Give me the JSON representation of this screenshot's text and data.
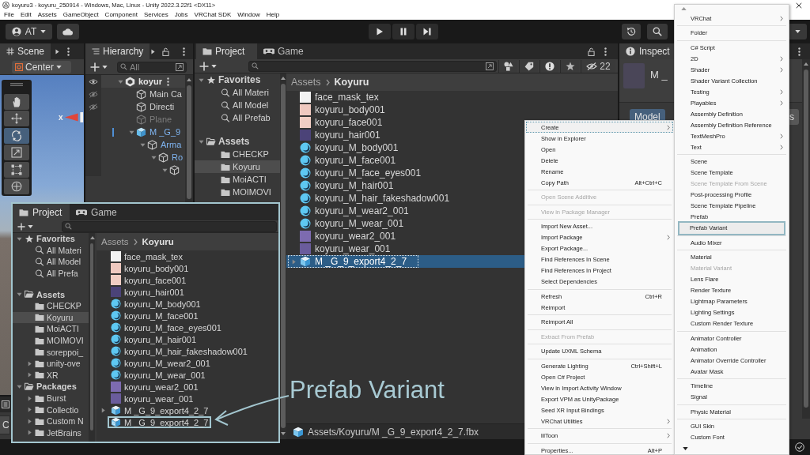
{
  "window": {
    "title": "koyuru3 - koyuru_250914 - Windows, Mac, Linux - Unity 2022.3.22f1 <DX11>"
  },
  "menu_bar": [
    "File",
    "Edit",
    "Assets",
    "GameObject",
    "Component",
    "Services",
    "Jobs",
    "VRChat SDK",
    "Window",
    "Help"
  ],
  "toolbar": {
    "account": "AT"
  },
  "scene": {
    "tab": "Scene",
    "pivot": "Center",
    "axis_label": "x",
    "tools": [
      {
        "kind": "hand",
        "selected": false
      },
      {
        "kind": "move",
        "selected": false
      },
      {
        "kind": "rotate",
        "selected": true
      },
      {
        "kind": "scale",
        "selected": false
      },
      {
        "kind": "rect",
        "selected": false
      },
      {
        "kind": "transform",
        "selected": false
      }
    ]
  },
  "hierarchy": {
    "tab": "Hierarchy",
    "placeholder": "All",
    "items": [
      {
        "label": "koyur",
        "kind": "scene",
        "scene_visible": true,
        "active": true,
        "expanded": true,
        "children": [
          {
            "label": "Main Ca",
            "kind": "object",
            "scene_visible": false,
            "active": true
          },
          {
            "label": "Directi",
            "kind": "object",
            "scene_visible": false,
            "active": true
          },
          {
            "label": "Plane",
            "kind": "object",
            "active": false
          },
          {
            "label": "M _G_9",
            "kind": "prefab",
            "active": true,
            "expanded": true,
            "children": [
              {
                "label": "Arma",
                "kind": "prefab_child",
                "active": true,
                "expanded": true,
                "children": [
                  {
                    "label": "Ro",
                    "kind": "prefab_child",
                    "active": true,
                    "expanded": true,
                    "children": [
                      {
                        "kind": "object",
                        "active": true,
                        "expanded": true
                      }
                    ]
                  }
                ]
              }
            ]
          }
        ]
      }
    ]
  },
  "console": {
    "button": "C"
  },
  "project": {
    "tabs": [
      {
        "kind": "project",
        "label": "Project",
        "selected": true
      },
      {
        "kind": "game",
        "label": "Game",
        "selected": false
      }
    ],
    "hidden_count": "22",
    "sidebar": [
      {
        "label": "Favorites",
        "kind": "favorites",
        "expanded": true,
        "selected": false,
        "children": [
          {
            "label": "All Materi",
            "kind": "search",
            "selected": false
          },
          {
            "label": "All Model",
            "kind": "search",
            "selected": false
          },
          {
            "label": "All Prefab",
            "kind": "search",
            "selected": false
          }
        ]
      },
      {
        "label": "Assets",
        "kind": "assets",
        "expanded": true,
        "selected": false,
        "children": [
          {
            "label": "CHECKP",
            "kind": "folder",
            "selected": false
          },
          {
            "label": "Koyuru",
            "kind": "folder",
            "selected": true
          },
          {
            "label": "MoiACTI",
            "kind": "folder",
            "selected": false
          },
          {
            "label": "MOIMOVI",
            "kind": "folder",
            "selected": false
          }
        ]
      }
    ],
    "breadcrumb": [
      "Assets",
      "Koyuru"
    ],
    "assets": [
      {
        "name": "face_mask_tex",
        "kind": "texture",
        "color": "#f2f2f2",
        "selected": false
      },
      {
        "name": "koyuru_body001",
        "kind": "texture",
        "color": "#efc9c0",
        "selected": false
      },
      {
        "name": "koyuru_face001",
        "kind": "texture",
        "color": "#f1cec4",
        "selected": false
      },
      {
        "name": "koyuru_hair001",
        "kind": "texture",
        "color": "#4b4378",
        "selected": false
      },
      {
        "name": "koyuru_M_body001",
        "kind": "material",
        "selected": false
      },
      {
        "name": "koyuru_M_face001",
        "kind": "material",
        "selected": false
      },
      {
        "name": "koyuru_M_face_eyes001",
        "kind": "material",
        "selected": false
      },
      {
        "name": "koyuru_M_hair001",
        "kind": "material",
        "selected": false
      },
      {
        "name": "koyuru_M_hair_fakeshadow001",
        "kind": "material",
        "selected": false
      },
      {
        "name": "koyuru_M_wear2_001",
        "kind": "material",
        "selected": false
      },
      {
        "name": "koyuru_M_wear_001",
        "kind": "material",
        "selected": false
      },
      {
        "name": "koyuru_wear2_001",
        "kind": "texture",
        "color": "#7d6bb0",
        "selected": false
      },
      {
        "name": "koyuru_wear_001",
        "kind": "texture",
        "color": "#6a5c9c",
        "selected": false
      },
      {
        "name": "M _G_9_export4_2_7",
        "kind": "model",
        "expanded": false,
        "selected": true
      }
    ],
    "path": "Assets/Koyuru/M _G_9_export4_2_7.fbx"
  },
  "inspector": {
    "tab": "Inspect",
    "title": "M _",
    "tabs": [
      {
        "label": "Model",
        "selected": true
      },
      {
        "label": "s",
        "selected": false
      }
    ]
  },
  "callout": {
    "tabs": [
      {
        "kind": "project",
        "label": "Project",
        "selected": true
      },
      {
        "kind": "game",
        "label": "Game",
        "selected": false
      }
    ],
    "sidebar": [
      {
        "label": "Favorites",
        "kind": "favorites",
        "expanded": true,
        "selected": false,
        "children": [
          {
            "label": "All Materi",
            "kind": "search",
            "selected": false
          },
          {
            "label": "All Model",
            "kind": "search",
            "selected": false
          },
          {
            "label": "All Prefa",
            "kind": "search",
            "selected": false
          }
        ]
      },
      {
        "label": "Assets",
        "kind": "assets",
        "expanded": true,
        "selected": false,
        "children": [
          {
            "label": "CHECKP",
            "kind": "folder",
            "selected": false
          },
          {
            "label": "Koyuru",
            "kind": "folder",
            "selected": true
          },
          {
            "label": "MoiACTI",
            "kind": "folder",
            "selected": false
          },
          {
            "label": "MOIMOVI",
            "kind": "folder",
            "selected": false
          },
          {
            "label": "soreppoi_",
            "kind": "folder",
            "selected": false
          },
          {
            "label": "unity-ove",
            "kind": "folder",
            "expanded": false,
            "selected": false
          },
          {
            "label": "XR",
            "kind": "folder",
            "expanded": false,
            "selected": false
          }
        ]
      },
      {
        "label": "Packages",
        "kind": "packages",
        "expanded": true,
        "selected": false,
        "children": [
          {
            "label": "Burst",
            "kind": "folder",
            "expanded": false,
            "selected": false
          },
          {
            "label": "Collectio",
            "kind": "folder",
            "expanded": false,
            "selected": false
          },
          {
            "label": "Custom N",
            "kind": "folder",
            "expanded": false,
            "selected": false
          },
          {
            "label": "JetBrains",
            "kind": "folder",
            "expanded": false,
            "selected": false
          }
        ]
      }
    ],
    "breadcrumb": [
      "Assets",
      "Koyuru"
    ],
    "assets": [
      {
        "name": "face_mask_tex",
        "kind": "texture",
        "color": "#f2f2f2",
        "outlined": false
      },
      {
        "name": "koyuru_body001",
        "kind": "texture",
        "color": "#efc9c0",
        "outlined": false
      },
      {
        "name": "koyuru_face001",
        "kind": "texture",
        "color": "#f1cec4",
        "outlined": false
      },
      {
        "name": "koyuru_hair001",
        "kind": "texture",
        "color": "#4b4378",
        "outlined": false
      },
      {
        "name": "koyuru_M_body001",
        "kind": "material",
        "outlined": false
      },
      {
        "name": "koyuru_M_face001",
        "kind": "material",
        "outlined": false
      },
      {
        "name": "koyuru_M_face_eyes001",
        "kind": "material",
        "outlined": false
      },
      {
        "name": "koyuru_M_hair001",
        "kind": "material",
        "outlined": false
      },
      {
        "name": "koyuru_M_hair_fakeshadow001",
        "kind": "material",
        "outlined": false
      },
      {
        "name": "koyuru_M_wear2_001",
        "kind": "material",
        "outlined": false
      },
      {
        "name": "koyuru_M_wear_001",
        "kind": "material",
        "outlined": false
      },
      {
        "name": "koyuru_wear2_001",
        "kind": "texture",
        "color": "#7d6bb0",
        "outlined": false
      },
      {
        "name": "koyuru_wear_001",
        "kind": "texture",
        "color": "#6a5c9c",
        "outlined": false
      },
      {
        "name": "M _G_9_export4_2_7",
        "kind": "model",
        "expanded": false,
        "outlined": false
      },
      {
        "name": "M _G_9_export4_2_7",
        "kind": "variant",
        "outlined": true
      }
    ]
  },
  "annotation": {
    "label": "Prefab Variant"
  },
  "context_menu": {
    "items": [
      {
        "kind": "item",
        "label": "Create",
        "selected": true,
        "disabled": false,
        "submenu": true
      },
      {
        "kind": "item",
        "label": "Show in Explorer",
        "selected": false,
        "disabled": false,
        "submenu": false
      },
      {
        "kind": "item",
        "label": "Open",
        "selected": false,
        "disabled": false,
        "submenu": false
      },
      {
        "kind": "item",
        "label": "Delete",
        "selected": false,
        "disabled": false,
        "submenu": false
      },
      {
        "kind": "item",
        "label": "Rename",
        "selected": false,
        "disabled": false,
        "submenu": false
      },
      {
        "kind": "item",
        "label": "Copy Path",
        "shortcut": "Alt+Ctrl+C",
        "selected": false,
        "disabled": false,
        "submenu": false
      },
      {
        "kind": "separator"
      },
      {
        "kind": "item",
        "label": "Open Scene Additive",
        "selected": false,
        "disabled": true,
        "submenu": false
      },
      {
        "kind": "separator"
      },
      {
        "kind": "item",
        "label": "View in Package Manager",
        "selected": false,
        "disabled": true,
        "submenu": false
      },
      {
        "kind": "separator"
      },
      {
        "kind": "item",
        "label": "Import New Asset...",
        "selected": false,
        "disabled": false,
        "submenu": false
      },
      {
        "kind": "item",
        "label": "Import Package",
        "selected": false,
        "disabled": false,
        "submenu": true
      },
      {
        "kind": "item",
        "label": "Export Package...",
        "selected": false,
        "disabled": false,
        "submenu": false
      },
      {
        "kind": "item",
        "label": "Find References In Scene",
        "selected": false,
        "disabled": false,
        "submenu": false
      },
      {
        "kind": "item",
        "label": "Find References In Project",
        "selected": false,
        "disabled": false,
        "submenu": false
      },
      {
        "kind": "item",
        "label": "Select Dependencies",
        "selected": false,
        "disabled": false,
        "submenu": false
      },
      {
        "kind": "separator"
      },
      {
        "kind": "item",
        "label": "Refresh",
        "shortcut": "Ctrl+R",
        "selected": false,
        "disabled": false,
        "submenu": false
      },
      {
        "kind": "item",
        "label": "Reimport",
        "selected": false,
        "disabled": false,
        "submenu": false
      },
      {
        "kind": "separator"
      },
      {
        "kind": "item",
        "label": "Reimport All",
        "selected": false,
        "disabled": false,
        "submenu": false
      },
      {
        "kind": "separator"
      },
      {
        "kind": "item",
        "label": "Extract From Prefab",
        "selected": false,
        "disabled": true,
        "submenu": false
      },
      {
        "kind": "separator"
      },
      {
        "kind": "item",
        "label": "Update UXML Schema",
        "selected": false,
        "disabled": false,
        "submenu": false
      },
      {
        "kind": "separator"
      },
      {
        "kind": "item",
        "label": "Generate Lighting",
        "shortcut": "Ctrl+Shift+L",
        "selected": false,
        "disabled": false,
        "submenu": false
      },
      {
        "kind": "item",
        "label": "Open C# Project",
        "selected": false,
        "disabled": false,
        "submenu": false
      },
      {
        "kind": "item",
        "label": "View in Import Activity Window",
        "selected": false,
        "disabled": false,
        "submenu": false
      },
      {
        "kind": "item",
        "label": "Export VPM as UnityPackage",
        "selected": false,
        "disabled": false,
        "submenu": false
      },
      {
        "kind": "item",
        "label": "Seed XR Input Bindings",
        "selected": false,
        "disabled": false,
        "submenu": false
      },
      {
        "kind": "item",
        "label": "VRChat Utilities",
        "selected": false,
        "disabled": false,
        "submenu": true
      },
      {
        "kind": "separator"
      },
      {
        "kind": "item",
        "label": "lilToon",
        "selected": false,
        "disabled": false,
        "submenu": true
      },
      {
        "kind": "separator"
      },
      {
        "kind": "item",
        "label": "Properties...",
        "shortcut": "Alt+P",
        "selected": false,
        "disabled": false,
        "submenu": false
      }
    ]
  },
  "create_submenu": {
    "items": [
      {
        "kind": "item",
        "label": "VRChat",
        "selected": false,
        "disabled": false,
        "submenu": true
      },
      {
        "kind": "separator"
      },
      {
        "kind": "item",
        "label": "Folder",
        "selected": false,
        "disabled": false,
        "submenu": false
      },
      {
        "kind": "separator"
      },
      {
        "kind": "item",
        "label": "C# Script",
        "selected": false,
        "disabled": false,
        "submenu": false
      },
      {
        "kind": "item",
        "label": "2D",
        "selected": false,
        "disabled": false,
        "submenu": true
      },
      {
        "kind": "item",
        "label": "Shader",
        "selected": false,
        "disabled": false,
        "submenu": true
      },
      {
        "kind": "item",
        "label": "Shader Variant Collection",
        "selected": false,
        "disabled": false,
        "submenu": false
      },
      {
        "kind": "item",
        "label": "Testing",
        "selected": false,
        "disabled": false,
        "submenu": true
      },
      {
        "kind": "item",
        "label": "Playables",
        "selected": false,
        "disabled": false,
        "submenu": true
      },
      {
        "kind": "item",
        "label": "Assembly Definition",
        "selected": false,
        "disabled": false,
        "submenu": false
      },
      {
        "kind": "item",
        "label": "Assembly Definition Reference",
        "selected": false,
        "disabled": false,
        "submenu": false
      },
      {
        "kind": "item",
        "label": "TextMeshPro",
        "selected": false,
        "disabled": false,
        "submenu": true
      },
      {
        "kind": "item",
        "label": "Text",
        "selected": false,
        "disabled": false,
        "submenu": true
      },
      {
        "kind": "separator"
      },
      {
        "kind": "item",
        "label": "Scene",
        "selected": false,
        "disabled": false,
        "submenu": false
      },
      {
        "kind": "item",
        "label": "Scene Template",
        "selected": false,
        "disabled": false,
        "submenu": false
      },
      {
        "kind": "item",
        "label": "Scene Template From Scene",
        "selected": false,
        "disabled": true,
        "submenu": false
      },
      {
        "kind": "item",
        "label": "Post-processing Profile",
        "selected": false,
        "disabled": false,
        "submenu": false
      },
      {
        "kind": "item",
        "label": "Scene Template Pipeline",
        "selected": false,
        "disabled": false,
        "submenu": false
      },
      {
        "kind": "item",
        "label": "Prefab",
        "selected": false,
        "disabled": false,
        "submenu": false
      },
      {
        "kind": "item",
        "label": "Prefab Variant",
        "selected": true,
        "disabled": false,
        "submenu": false
      },
      {
        "kind": "separator"
      },
      {
        "kind": "item",
        "label": "Audio Mixer",
        "selected": false,
        "disabled": false,
        "submenu": false
      },
      {
        "kind": "separator"
      },
      {
        "kind": "item",
        "label": "Material",
        "selected": false,
        "disabled": false,
        "submenu": false
      },
      {
        "kind": "item",
        "label": "Material Variant",
        "selected": false,
        "disabled": true,
        "submenu": false
      },
      {
        "kind": "item",
        "label": "Lens Flare",
        "selected": false,
        "disabled": false,
        "submenu": false
      },
      {
        "kind": "item",
        "label": "Render Texture",
        "selected": false,
        "disabled": false,
        "submenu": false
      },
      {
        "kind": "item",
        "label": "Lightmap Parameters",
        "selected": false,
        "disabled": false,
        "submenu": false
      },
      {
        "kind": "item",
        "label": "Lighting Settings",
        "selected": false,
        "disabled": false,
        "submenu": false
      },
      {
        "kind": "item",
        "label": "Custom Render Texture",
        "selected": false,
        "disabled": false,
        "submenu": false
      },
      {
        "kind": "separator"
      },
      {
        "kind": "item",
        "label": "Animator Controller",
        "selected": false,
        "disabled": false,
        "submenu": false
      },
      {
        "kind": "item",
        "label": "Animation",
        "selected": false,
        "disabled": false,
        "submenu": false
      },
      {
        "kind": "item",
        "label": "Animator Override Controller",
        "selected": false,
        "disabled": false,
        "submenu": false
      },
      {
        "kind": "item",
        "label": "Avatar Mask",
        "selected": false,
        "disabled": false,
        "submenu": false
      },
      {
        "kind": "separator"
      },
      {
        "kind": "item",
        "label": "Timeline",
        "selected": false,
        "disabled": false,
        "submenu": false
      },
      {
        "kind": "item",
        "label": "Signal",
        "selected": false,
        "disabled": false,
        "submenu": false
      },
      {
        "kind": "separator"
      },
      {
        "kind": "item",
        "label": "Physic Material",
        "selected": false,
        "disabled": false,
        "submenu": false
      },
      {
        "kind": "separator"
      },
      {
        "kind": "item",
        "label": "GUI Skin",
        "selected": false,
        "disabled": false,
        "submenu": false
      },
      {
        "kind": "item",
        "label": "Custom Font",
        "selected": false,
        "disabled": false,
        "submenu": false
      }
    ]
  }
}
